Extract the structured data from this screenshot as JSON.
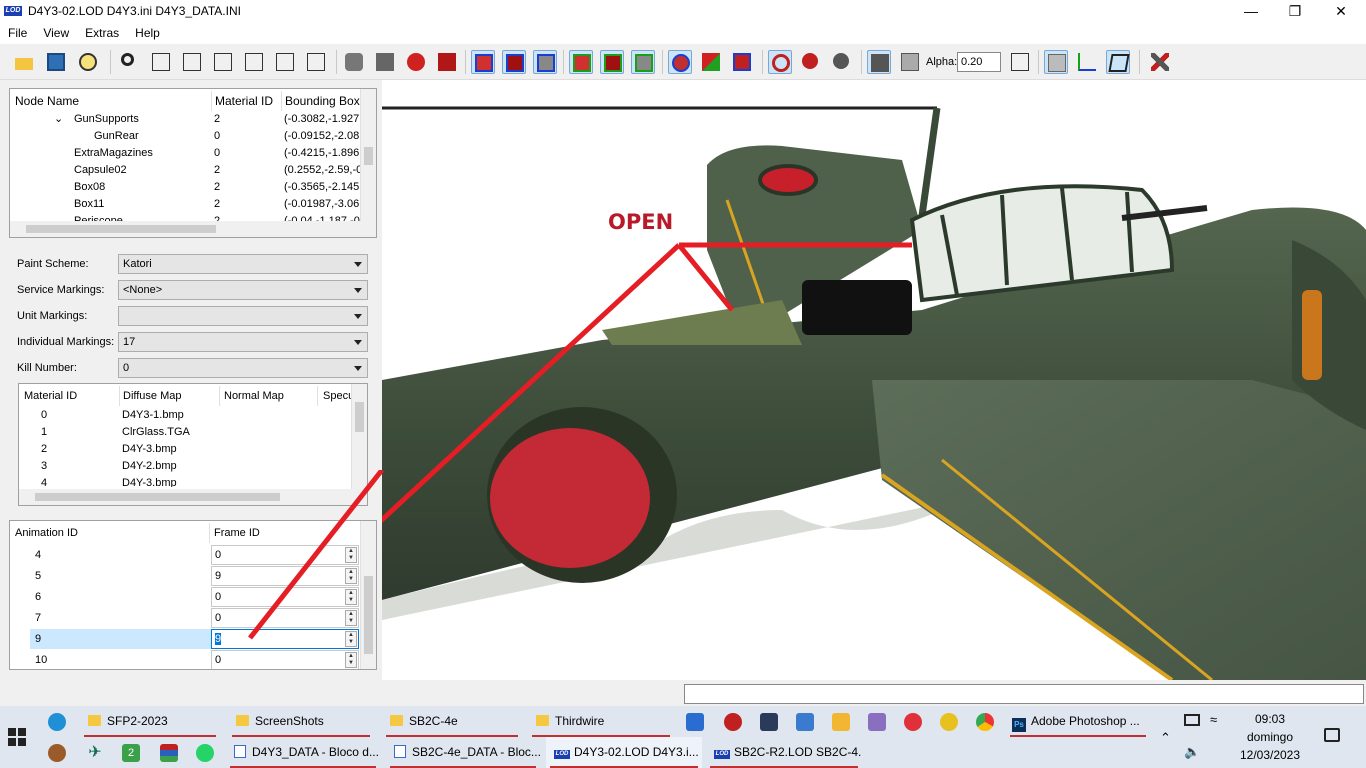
{
  "window": {
    "title": "D4Y3-02.LOD  D4Y3.ini  D4Y3_DATA.INI",
    "app_badge": "LOD"
  },
  "menu": [
    "File",
    "View",
    "Extras",
    "Help"
  ],
  "toolbar": {
    "alpha_label": "Alpha:",
    "alpha_value": "0.20"
  },
  "node_list": {
    "headers": [
      "Node Name",
      "Material ID",
      "Bounding Box"
    ],
    "rows": [
      {
        "name": "GunSupports",
        "material": "2",
        "bbox": "(-0.3082,-1.927"
      },
      {
        "name": "GunRear",
        "material": "0",
        "bbox": "(-0.09152,-2.08"
      },
      {
        "name": "ExtraMagazines",
        "material": "0",
        "bbox": "(-0.4215,-1.896"
      },
      {
        "name": "Capsule02",
        "material": "2",
        "bbox": "(0.2552,-2.59,-0"
      },
      {
        "name": "Box08",
        "material": "2",
        "bbox": "(-0.3565,-2.145"
      },
      {
        "name": "Box11",
        "material": "2",
        "bbox": "(-0.01987,-3.06"
      },
      {
        "name": "Periscope",
        "material": "2",
        "bbox": "(-0.04,-1.187,-0"
      }
    ]
  },
  "fields": {
    "paint_scheme": {
      "label": "Paint Scheme:",
      "value": "Katori"
    },
    "service_markings": {
      "label": "Service Markings:",
      "value": "<None>"
    },
    "unit_markings": {
      "label": "Unit Markings:",
      "value": ""
    },
    "individual_markings": {
      "label": "Individual Markings:",
      "value": "17"
    },
    "kill_number": {
      "label": "Kill Number:",
      "value": "0"
    }
  },
  "material_list": {
    "headers": [
      "Material ID",
      "Diffuse Map",
      "Normal Map",
      "Specu"
    ],
    "rows": [
      {
        "id": "0",
        "diffuse": "D4Y3-1.bmp"
      },
      {
        "id": "1",
        "diffuse": "ClrGlass.TGA"
      },
      {
        "id": "2",
        "diffuse": "D4Y-3.bmp"
      },
      {
        "id": "3",
        "diffuse": "D4Y-2.bmp"
      },
      {
        "id": "4",
        "diffuse": "D4Y-3.bmp"
      }
    ]
  },
  "animation_list": {
    "headers": [
      "Animation ID",
      "Frame ID"
    ],
    "rows": [
      {
        "id": "4",
        "frame": "0"
      },
      {
        "id": "5",
        "frame": "9"
      },
      {
        "id": "6",
        "frame": "0"
      },
      {
        "id": "7",
        "frame": "0"
      },
      {
        "id": "9",
        "frame": "9"
      },
      {
        "id": "10",
        "frame": "0"
      }
    ]
  },
  "viewport": {
    "annotation": "OPEN"
  },
  "taskbar": {
    "top_row": [
      "SFP2-2023",
      "ScreenShots",
      "SB2C-4e",
      "Thirdwire",
      "Adobe Photoshop ..."
    ],
    "bottom_row": [
      "D4Y3_DATA - Bloco d...",
      "SB2C-4e_DATA - Bloc...",
      "D4Y3-02.LOD  D4Y3.i...",
      "SB2C-R2.LOD  SB2C-4..."
    ],
    "clock": {
      "time": "09:03",
      "day": "domingo",
      "date": "12/03/2023"
    }
  }
}
